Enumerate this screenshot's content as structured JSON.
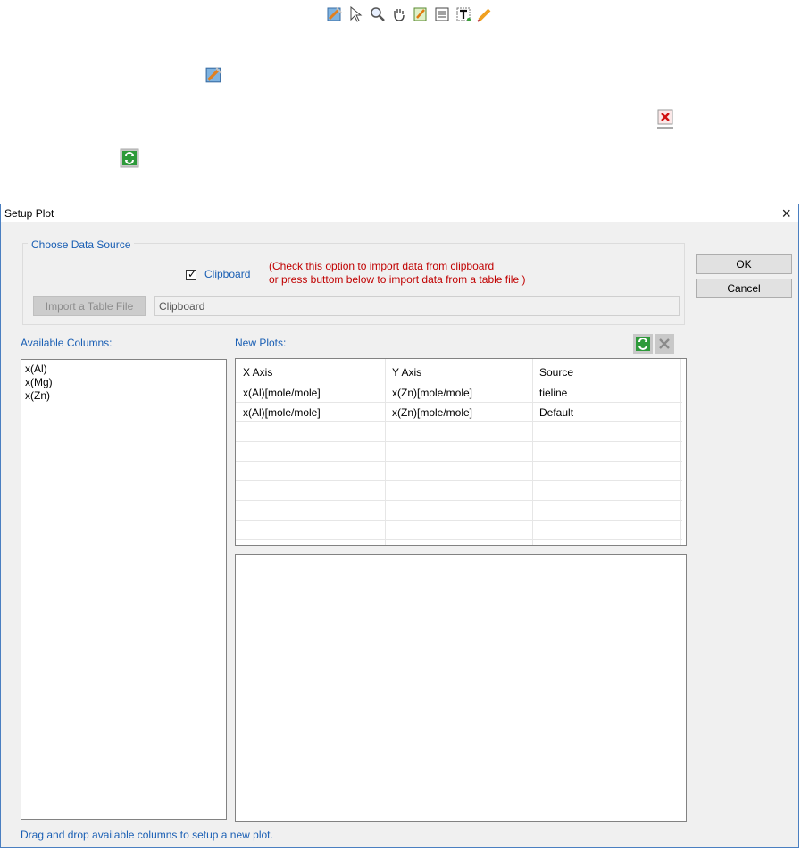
{
  "toolbar": {
    "icons": [
      "data-edit-icon",
      "pointer-icon",
      "zoom-icon",
      "pan-hand-icon",
      "edit-note-icon",
      "legend-icon",
      "text-insert-icon",
      "pencil-icon"
    ]
  },
  "underline_field": {
    "value": ""
  },
  "dialog": {
    "title": "Setup Plot",
    "close_glyph": "×",
    "group_label": "Choose Data Source",
    "clipboard_label": "Clipboard",
    "clipboard_checked": true,
    "hint_line1": "(Check this option to import data from clipboard",
    "hint_line2": "or press buttom below to import data from a table file )",
    "import_button": "Import a Table File",
    "source_value": "Clipboard",
    "ok_button": "OK",
    "cancel_button": "Cancel",
    "available_label": "Available Columns:",
    "available_columns": [
      "x(Al)",
      "x(Mg)",
      "x(Zn)"
    ],
    "new_plots_label": "New Plots:",
    "grid": {
      "headers": [
        "X Axis",
        "Y Axis",
        "Source"
      ],
      "rows": [
        [
          "x(Al)[mole/mole]",
          "x(Zn)[mole/mole]",
          "tieline"
        ],
        [
          "x(Al)[mole/mole]",
          "x(Zn)[mole/mole]",
          "Default"
        ]
      ]
    },
    "footer": "Drag and drop available columns to setup a new plot."
  },
  "colors": {
    "accent_blue": "#1a5fb4",
    "hint_red": "#c00000",
    "border_blue": "#4a7fc1"
  }
}
